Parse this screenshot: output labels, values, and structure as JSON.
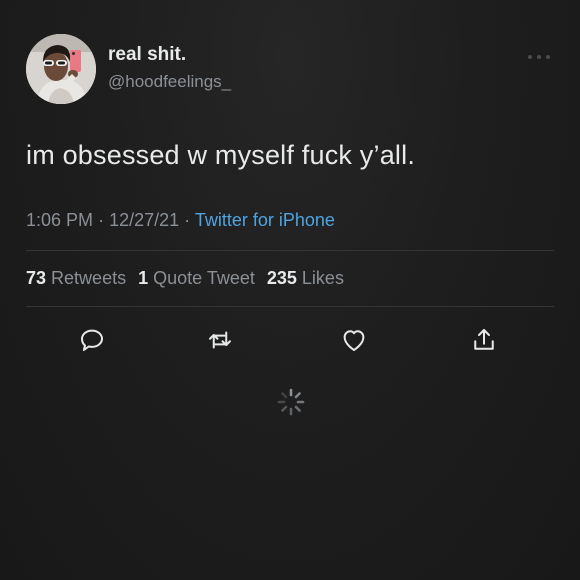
{
  "tweet": {
    "display_name": "real shit.",
    "handle": "@hoodfeelings_",
    "text": "im obsessed w myself fuck y’all.",
    "time": "1:06 PM",
    "date": "12/27/21",
    "separator": "·",
    "source": "Twitter for iPhone"
  },
  "stats": {
    "retweets_count": "73",
    "retweets_label": "Retweets",
    "quotes_count": "1",
    "quotes_label": "Quote Tweet",
    "likes_count": "235",
    "likes_label": "Likes"
  },
  "actions": {
    "reply_icon": "reply-icon",
    "retweet_icon": "retweet-icon",
    "like_icon": "heart-icon",
    "share_icon": "share-icon"
  },
  "colors": {
    "background": "#1c1c1c",
    "text_primary": "#e7e9ea",
    "text_secondary": "#8b9096",
    "link": "#4fa3e0"
  }
}
